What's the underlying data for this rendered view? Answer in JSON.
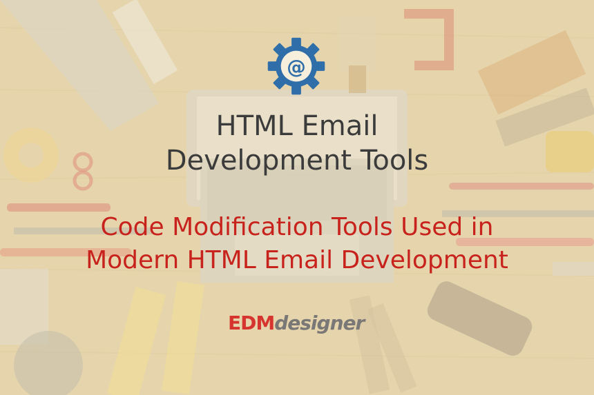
{
  "header": {
    "icon": "gear-at-icon",
    "title_line1": "HTML Email",
    "title_line2": "Development Tools"
  },
  "subtitle": {
    "line1": "Code Modification Tools Used in",
    "line2": "Modern HTML Email Development"
  },
  "logo": {
    "part1": "EDM",
    "part2": "designer"
  },
  "colors": {
    "title": "#3b3b3b",
    "subtitle": "#c8221d",
    "gear": "#2f6ea8",
    "logo_red": "#d6352f",
    "logo_grey": "#7a7876",
    "background_tint": "#eee0bc"
  }
}
